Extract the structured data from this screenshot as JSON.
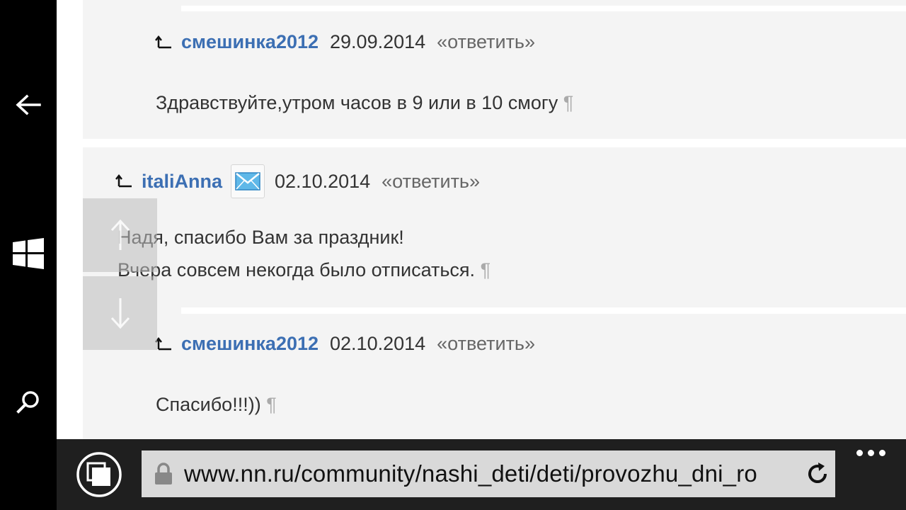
{
  "comments": [
    {
      "author": "смешинка2012",
      "date": "29.09.2014",
      "reply": "«ответить»",
      "lines": [
        "Здравствуйте,утром часов в 9 или в 10 смогу"
      ]
    },
    {
      "author": "italiAnna",
      "date": "02.10.2014",
      "reply": "«ответить»",
      "lines": [
        "Надя, спасибо Вам за праздник!",
        "Вчера совсем некогда было отписаться."
      ]
    },
    {
      "author": "смешинка2012",
      "date": "02.10.2014",
      "reply": "«ответить»",
      "lines": [
        "Спасибо!!!))"
      ]
    }
  ],
  "pilcrow": "¶",
  "browser": {
    "url": "www.nn.ru/community/nashi_deti/deti/provozhu_dni_ro"
  },
  "icons": {
    "back": "back-arrow-icon",
    "windows": "windows-logo-icon",
    "search": "search-icon",
    "reply": "reply-arrow-icon",
    "mail": "mail-icon",
    "scroll_up": "arrow-up-icon",
    "scroll_down": "arrow-down-icon",
    "tabs": "tabs-icon",
    "lock": "lock-icon",
    "refresh": "refresh-icon",
    "more": "more-icon"
  },
  "colors": {
    "author": "#3c6fb3",
    "comment_bg": "#f4f4f4",
    "address_bar": "#d9d9d9"
  }
}
